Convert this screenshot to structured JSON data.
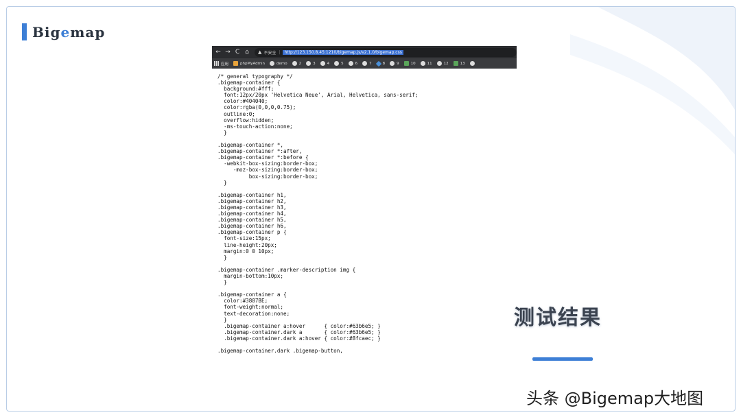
{
  "brand": {
    "prefix": "Big",
    "accent": "e",
    "suffix": "map"
  },
  "browser": {
    "nav_icons": [
      "back-icon",
      "forward-icon",
      "reload-icon",
      "home-icon"
    ],
    "security_label": "不安全",
    "url": "http://123.150.8.45:1210/bigemap.js/v2.1.0/bigemap.css",
    "bookmarks": [
      {
        "icon": "apps-grid-icon",
        "label": "应用"
      },
      {
        "icon": "phpmyadmin-icon",
        "label": "phpMyAdmin"
      },
      {
        "icon": "globe-icon",
        "label": "demo"
      },
      {
        "icon": "globe-icon",
        "label": "2"
      },
      {
        "icon": "globe-icon",
        "label": "3"
      },
      {
        "icon": "globe-icon",
        "label": "4"
      },
      {
        "icon": "globe-icon",
        "label": "5"
      },
      {
        "icon": "globe-icon",
        "label": "6"
      },
      {
        "icon": "globe-icon",
        "label": "7"
      },
      {
        "icon": "diamond-icon",
        "label": "8"
      },
      {
        "icon": "globe-icon",
        "label": "9"
      },
      {
        "icon": "image-icon",
        "label": "10"
      },
      {
        "icon": "globe-icon",
        "label": "11"
      },
      {
        "icon": "globe-icon",
        "label": "12"
      },
      {
        "icon": "image-icon",
        "label": "13"
      },
      {
        "icon": "globe-icon",
        "label": ""
      }
    ]
  },
  "code_lines": [
    "/* general typography */",
    ".bigemap-container {",
    "  background:#fff;",
    "  font:12px/20px 'Helvetica Neue', Arial, Helvetica, sans-serif;",
    "  color:#404040;",
    "  color:rgba(0,0,0,0.75);",
    "  outline:0;",
    "  overflow:hidden;",
    "  -ms-touch-action:none;",
    "  }",
    "",
    ".bigemap-container *,",
    ".bigemap-container *:after,",
    ".bigemap-container *:before {",
    "  -webkit-box-sizing:border-box;",
    "     -moz-box-sizing:border-box;",
    "          box-sizing:border-box;",
    "  }",
    "",
    ".bigemap-container h1,",
    ".bigemap-container h2,",
    ".bigemap-container h3,",
    ".bigemap-container h4,",
    ".bigemap-container h5,",
    ".bigemap-container h6,",
    ".bigemap-container p {",
    "  font-size:15px;",
    "  line-height:20px;",
    "  margin:0 0 10px;",
    "  }",
    "",
    ".bigemap-container .marker-description img {",
    "  margin-bottom:10px;",
    "  }",
    "",
    ".bigemap-container a {",
    "  color:#3887BE;",
    "  font-weight:normal;",
    "  text-decoration:none;",
    "  }",
    "  .bigemap-container a:hover      { color:#63b6e5; }",
    "  .bigemap-container.dark a       { color:#63b6e5; }",
    "  .bigemap-container.dark a:hover { color:#8fcaec; }",
    "",
    ".bigemap-container.dark .bigemap-button,"
  ],
  "result_title": "测试结果",
  "watermark": "头条 @Bigemap大地图",
  "colors": {
    "accent": "#3d7fd6",
    "frame": "#b9cde6",
    "browser_bar": "#2b2c2f"
  }
}
